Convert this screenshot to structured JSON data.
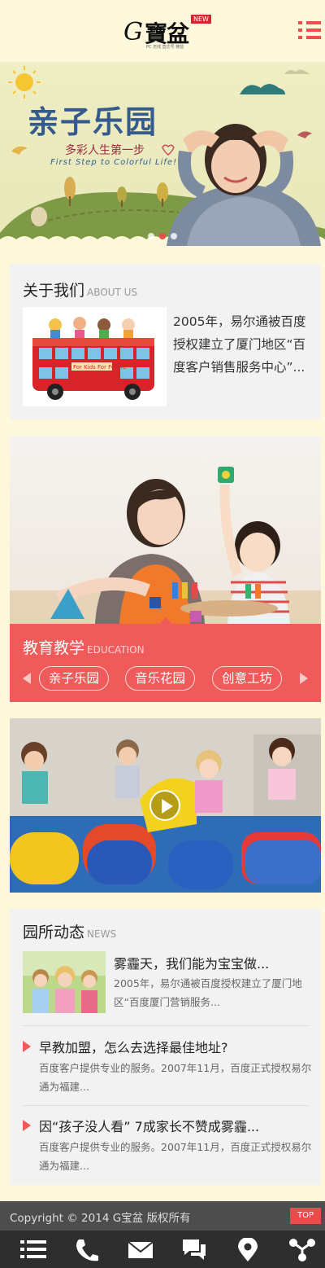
{
  "header": {
    "logo_g": "G",
    "logo_cn": "寶盆",
    "logo_badge": "NEW",
    "logo_sub": "PC  无线  直达号  微信",
    "menu_icon": "hamburger-menu-icon"
  },
  "banner": {
    "title": "亲子乐园",
    "subtitle": "多彩人生第一步",
    "subtitle_en": "First Step to Colorful Life!",
    "dots_total": 3,
    "dots_active": 2
  },
  "about": {
    "title": "关于我们",
    "title_en": "ABOUT US",
    "bus_text": "For Kids For Future",
    "text": "2005年，易尔通被百度授权建立了厦门地区“百度客户销售服务中心”..."
  },
  "education": {
    "title": "教育教学",
    "title_en": "EDUCATION",
    "tabs": [
      "亲子乐园",
      "音乐花园",
      "创意工坊"
    ]
  },
  "video": {
    "play_icon": "play-icon"
  },
  "news": {
    "title": "园所动态",
    "title_en": "NEWS",
    "first": {
      "title": "雾霾天，我们能为宝宝做...",
      "text": "2005年，易尔通被百度授权建立了厦门地区“百度厦门营销服务..."
    },
    "items": [
      {
        "title": "早教加盟，怎么去选择最佳地址?",
        "text": "百度客户提供专业的服务。2007年11月，百度正式授权易尔通为福建..."
      },
      {
        "title": "因“孩子没人看” 7成家长不赞成雾霾...",
        "text": "百度客户提供专业的服务。2007年11月，百度正式授权易尔通为福建..."
      }
    ]
  },
  "footer": {
    "copyright": "Copyright © 2014 G宝盆 版权所有",
    "top_label": "TOP"
  },
  "bottom_nav": [
    "list-icon",
    "phone-icon",
    "mail-icon",
    "chat-icon",
    "location-pin-icon",
    "share-icon"
  ],
  "colors": {
    "accent": "#ef5b5b",
    "background": "#fdf8dc",
    "card": "#f2f2f2",
    "footer": "#4d4d4d",
    "nav": "#2e2e2e"
  }
}
